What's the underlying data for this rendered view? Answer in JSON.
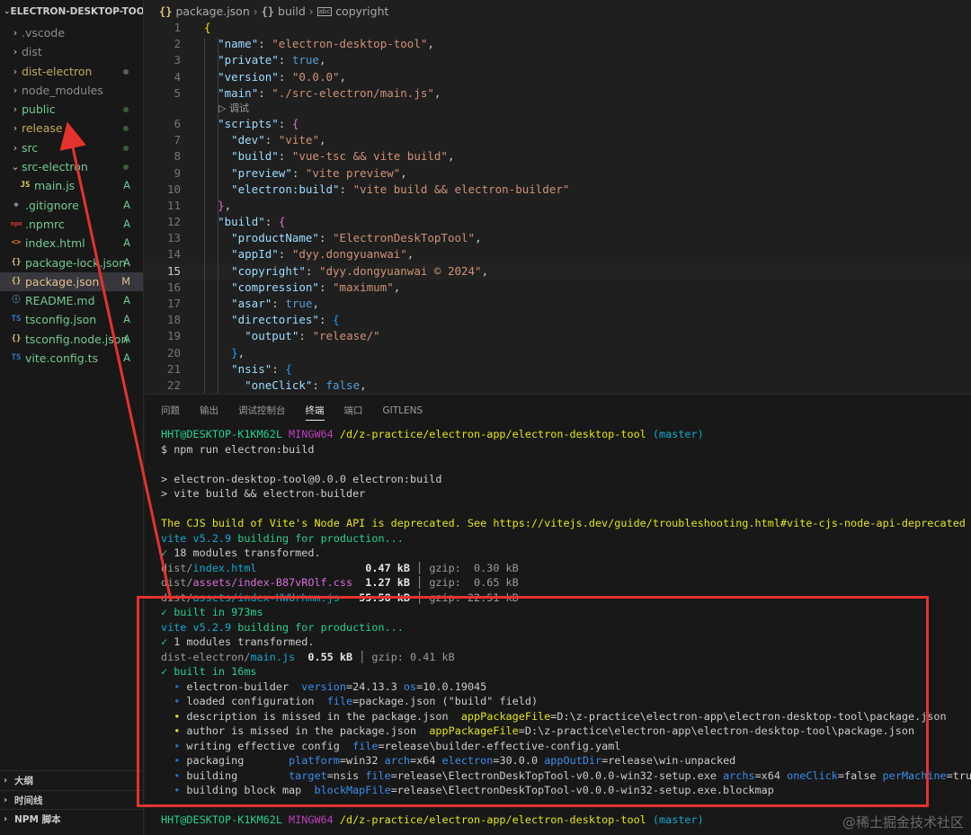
{
  "explorer": {
    "title": "ELECTRON-DESKTOP-TOOL",
    "items": [
      {
        "label": "vscode",
        "prefix": ".",
        "kind": "folder",
        "status": "",
        "dot": false
      },
      {
        "label": "dist",
        "kind": "folder",
        "status": "",
        "dot": false
      },
      {
        "label": "dist-electron",
        "kind": "folder",
        "status": "",
        "dot": true
      },
      {
        "label": "node_modules",
        "kind": "folder",
        "status": "",
        "dot": false
      },
      {
        "label": "public",
        "kind": "folder",
        "status": "",
        "dot": true
      },
      {
        "label": "release",
        "kind": "folder",
        "status": "",
        "dot": true
      },
      {
        "label": "src",
        "kind": "folder",
        "status": "",
        "dot": true
      },
      {
        "label": "src-electron",
        "kind": "folder-open",
        "status": "",
        "dot": true
      },
      {
        "label": "main.js",
        "kind": "file",
        "icon": "JS",
        "status": "A"
      },
      {
        "label": ".gitignore",
        "kind": "file",
        "icon": "◆",
        "status": "A"
      },
      {
        "label": ".npmrc",
        "kind": "file",
        "icon": "npm",
        "status": "A"
      },
      {
        "label": "index.html",
        "kind": "file",
        "icon": "<>",
        "status": "A"
      },
      {
        "label": "package-lock.json",
        "kind": "file",
        "icon": "{}",
        "status": "A"
      },
      {
        "label": "package.json",
        "kind": "file",
        "icon": "{}",
        "status": "M"
      },
      {
        "label": "README.md",
        "kind": "file",
        "icon": "ⓘ",
        "status": "A"
      },
      {
        "label": "tsconfig.json",
        "kind": "file",
        "icon": "TS",
        "status": "A"
      },
      {
        "label": "tsconfig.node.json",
        "kind": "file",
        "icon": "{}",
        "status": "A"
      },
      {
        "label": "vite.config.ts",
        "kind": "file",
        "icon": "TS",
        "status": "A"
      }
    ],
    "outline": "大纲",
    "timeline": "时间线",
    "npm_scripts": "NPM 脚本"
  },
  "editor": {
    "breadcrumb": [
      "package.json",
      "build",
      "copyright"
    ],
    "codelens": "▷ 调试",
    "lines": [
      {
        "n": "1",
        "tokens": [
          [
            "br1",
            "{"
          ]
        ]
      },
      {
        "n": "2",
        "tokens": [
          [
            "p",
            "  "
          ],
          [
            "k",
            "\"name\""
          ],
          [
            "p",
            ": "
          ],
          [
            "s",
            "\"electron-desktop-tool\""
          ],
          [
            "p",
            ","
          ]
        ]
      },
      {
        "n": "3",
        "tokens": [
          [
            "p",
            "  "
          ],
          [
            "k",
            "\"private\""
          ],
          [
            "p",
            ": "
          ],
          [
            "b",
            "true"
          ],
          [
            "p",
            ","
          ]
        ]
      },
      {
        "n": "4",
        "tokens": [
          [
            "p",
            "  "
          ],
          [
            "k",
            "\"version\""
          ],
          [
            "p",
            ": "
          ],
          [
            "s",
            "\"0.0.0\""
          ],
          [
            "p",
            ","
          ]
        ]
      },
      {
        "n": "5",
        "tokens": [
          [
            "p",
            "  "
          ],
          [
            "k",
            "\"main\""
          ],
          [
            "p",
            ": "
          ],
          [
            "s",
            "\"./src-electron/main.js\""
          ],
          [
            "p",
            ","
          ]
        ]
      },
      {
        "n": "6",
        "tokens": [
          [
            "p",
            "  "
          ],
          [
            "k",
            "\"scripts\""
          ],
          [
            "p",
            ": "
          ],
          [
            "br2",
            "{"
          ]
        ]
      },
      {
        "n": "7",
        "tokens": [
          [
            "p",
            "    "
          ],
          [
            "k",
            "\"dev\""
          ],
          [
            "p",
            ": "
          ],
          [
            "s",
            "\"vite\""
          ],
          [
            "p",
            ","
          ]
        ]
      },
      {
        "n": "8",
        "tokens": [
          [
            "p",
            "    "
          ],
          [
            "k",
            "\"build\""
          ],
          [
            "p",
            ": "
          ],
          [
            "s",
            "\"vue-tsc && vite build\""
          ],
          [
            "p",
            ","
          ]
        ]
      },
      {
        "n": "9",
        "tokens": [
          [
            "p",
            "    "
          ],
          [
            "k",
            "\"preview\""
          ],
          [
            "p",
            ": "
          ],
          [
            "s",
            "\"vite preview\""
          ],
          [
            "p",
            ","
          ]
        ]
      },
      {
        "n": "10",
        "tokens": [
          [
            "p",
            "    "
          ],
          [
            "k",
            "\"electron:build\""
          ],
          [
            "p",
            ": "
          ],
          [
            "s",
            "\"vite build && electron-builder\""
          ]
        ]
      },
      {
        "n": "11",
        "tokens": [
          [
            "p",
            "  "
          ],
          [
            "br2",
            "}"
          ],
          [
            "p",
            ","
          ]
        ]
      },
      {
        "n": "12",
        "tokens": [
          [
            "p",
            "  "
          ],
          [
            "k",
            "\"build\""
          ],
          [
            "p",
            ": "
          ],
          [
            "br2",
            "{"
          ]
        ]
      },
      {
        "n": "13",
        "tokens": [
          [
            "p",
            "    "
          ],
          [
            "k",
            "\"productName\""
          ],
          [
            "p",
            ": "
          ],
          [
            "s",
            "\"ElectronDeskTopTool\""
          ],
          [
            "p",
            ","
          ]
        ]
      },
      {
        "n": "14",
        "tokens": [
          [
            "p",
            "    "
          ],
          [
            "k",
            "\"appId\""
          ],
          [
            "p",
            ": "
          ],
          [
            "s",
            "\"dyy.dongyuanwai\""
          ],
          [
            "p",
            ","
          ]
        ]
      },
      {
        "n": "15",
        "active": true,
        "tokens": [
          [
            "p",
            "    "
          ],
          [
            "k",
            "\"copyright\""
          ],
          [
            "p",
            ": "
          ],
          [
            "s",
            "\"dyy.dongyuanwai © 2024\""
          ],
          [
            "p",
            ","
          ]
        ]
      },
      {
        "n": "16",
        "tokens": [
          [
            "p",
            "    "
          ],
          [
            "k",
            "\"compression\""
          ],
          [
            "p",
            ": "
          ],
          [
            "s",
            "\"maximum\""
          ],
          [
            "p",
            ","
          ]
        ]
      },
      {
        "n": "17",
        "tokens": [
          [
            "p",
            "    "
          ],
          [
            "k",
            "\"asar\""
          ],
          [
            "p",
            ": "
          ],
          [
            "b",
            "true"
          ],
          [
            "p",
            ","
          ]
        ]
      },
      {
        "n": "18",
        "tokens": [
          [
            "p",
            "    "
          ],
          [
            "k",
            "\"directories\""
          ],
          [
            "p",
            ": "
          ],
          [
            "br3",
            "{"
          ]
        ]
      },
      {
        "n": "19",
        "tokens": [
          [
            "p",
            "      "
          ],
          [
            "k",
            "\"output\""
          ],
          [
            "p",
            ": "
          ],
          [
            "s",
            "\"release/\""
          ]
        ]
      },
      {
        "n": "20",
        "tokens": [
          [
            "p",
            "    "
          ],
          [
            "br3",
            "}"
          ],
          [
            "p",
            ","
          ]
        ]
      },
      {
        "n": "21",
        "tokens": [
          [
            "p",
            "    "
          ],
          [
            "k",
            "\"nsis\""
          ],
          [
            "p",
            ": "
          ],
          [
            "br3",
            "{"
          ]
        ]
      },
      {
        "n": "22",
        "tokens": [
          [
            "p",
            "      "
          ],
          [
            "k",
            "\"oneClick\""
          ],
          [
            "p",
            ": "
          ],
          [
            "b",
            "false"
          ],
          [
            "p",
            ","
          ]
        ]
      }
    ]
  },
  "panel": {
    "tabs": [
      {
        "label": "问题",
        "active": false
      },
      {
        "label": "输出",
        "active": false
      },
      {
        "label": "调试控制台",
        "active": false
      },
      {
        "label": "终端",
        "active": true
      },
      {
        "label": "端口",
        "active": false
      },
      {
        "label": "GITLENS",
        "active": false
      }
    ],
    "terminal": [
      [
        [
          "t-green",
          "HHT@DESKTOP-K1KM62L "
        ],
        [
          "t-purple",
          "MINGW64 "
        ],
        [
          "t-yellow",
          "/d/z-practice/electron-app/electron-desktop-tool"
        ],
        [
          "t-cyan",
          " (master)"
        ]
      ],
      [
        [
          "",
          "$ npm run electron:build"
        ]
      ],
      [
        [
          "",
          ""
        ]
      ],
      [
        [
          "",
          "> electron-desktop-tool@0.0.0 electron:build"
        ]
      ],
      [
        [
          "",
          "> vite build && electron-builder"
        ]
      ],
      [
        [
          "",
          ""
        ]
      ],
      [
        [
          "t-yellow",
          "The CJS build of Vite's Node API is deprecated. See https://vitejs.dev/guide/troubleshooting.html#vite-cjs-node-api-deprecated for mo"
        ]
      ],
      [
        [
          "t-cyan",
          "vite v5.2.9 "
        ],
        [
          "t-green",
          "building for production..."
        ]
      ],
      [
        [
          "t-green",
          "✓ "
        ],
        [
          "",
          "18 modules transformed."
        ]
      ],
      [
        [
          "t-dim",
          "dist/"
        ],
        [
          "t-cyan",
          "index.html"
        ],
        [
          "",
          "                 "
        ],
        [
          "t-bold",
          "0.47 kB"
        ],
        [
          "t-dim",
          " │ gzip:  0.30 kB"
        ]
      ],
      [
        [
          "t-dim",
          "dist/"
        ],
        [
          "t-magenta",
          "assets/index-B87vROlf.css"
        ],
        [
          "",
          "  "
        ],
        [
          "t-bold",
          "1.27 kB"
        ],
        [
          "t-dim",
          " │ gzip:  0.65 kB"
        ]
      ],
      [
        [
          "t-dim",
          "dist/"
        ],
        [
          "t-cyan",
          "assets/index-HWUrhmm.js"
        ],
        [
          "",
          "   "
        ],
        [
          "t-bold",
          "55.58 kB"
        ],
        [
          "t-dim",
          " │ gzip: 22.51 kB"
        ]
      ],
      [
        [
          "t-green",
          "✓ built in 973ms"
        ]
      ],
      [
        [
          "t-cyan",
          "vite v5.2.9 "
        ],
        [
          "t-green",
          "building for production..."
        ]
      ],
      [
        [
          "t-green",
          "✓ "
        ],
        [
          "",
          "1 modules transformed."
        ]
      ],
      [
        [
          "t-dim",
          "dist-electron/"
        ],
        [
          "t-cyan",
          "main.js"
        ],
        [
          "",
          "  "
        ],
        [
          "t-bold",
          "0.55 kB"
        ],
        [
          "t-dim",
          " │ gzip: 0.41 kB"
        ]
      ],
      [
        [
          "t-green",
          "✓ built in 16ms"
        ]
      ],
      [
        [
          "bullet-c",
          "  • "
        ],
        [
          "",
          "electron-builder  "
        ],
        [
          "t-lblue",
          "version"
        ],
        [
          "",
          "=24.13.3 "
        ],
        [
          "t-lblue",
          "os"
        ],
        [
          "",
          "=10.0.19045"
        ]
      ],
      [
        [
          "bullet-c",
          "  • "
        ],
        [
          "",
          "loaded configuration  "
        ],
        [
          "t-lblue",
          "file"
        ],
        [
          "",
          "=package.json (\"build\" field)"
        ]
      ],
      [
        [
          "bullet-y",
          "  • "
        ],
        [
          "",
          "description is missed in the package.json  "
        ],
        [
          "t-yellow",
          "appPackageFile"
        ],
        [
          "",
          "=D:\\z-practice\\electron-app\\electron-desktop-tool\\package.json"
        ]
      ],
      [
        [
          "bullet-y",
          "  • "
        ],
        [
          "",
          "author is missed in the package.json  "
        ],
        [
          "t-yellow",
          "appPackageFile"
        ],
        [
          "",
          "=D:\\z-practice\\electron-app\\electron-desktop-tool\\package.json"
        ]
      ],
      [
        [
          "bullet-c",
          "  • "
        ],
        [
          "",
          "writing effective config  "
        ],
        [
          "t-lblue",
          "file"
        ],
        [
          "",
          "=release\\builder-effective-config.yaml"
        ]
      ],
      [
        [
          "bullet-c",
          "  • "
        ],
        [
          "",
          "packaging       "
        ],
        [
          "t-lblue",
          "platform"
        ],
        [
          "",
          "=win32 "
        ],
        [
          "t-lblue",
          "arch"
        ],
        [
          "",
          "=x64 "
        ],
        [
          "t-lblue",
          "electron"
        ],
        [
          "",
          "=30.0.0 "
        ],
        [
          "t-lblue",
          "appOutDir"
        ],
        [
          "",
          "=release\\win-unpacked"
        ]
      ],
      [
        [
          "bullet-c",
          "  • "
        ],
        [
          "",
          "building        "
        ],
        [
          "t-lblue",
          "target"
        ],
        [
          "",
          "=nsis "
        ],
        [
          "t-lblue",
          "file"
        ],
        [
          "",
          "=release\\ElectronDeskTopTool-v0.0.0-win32-setup.exe "
        ],
        [
          "t-lblue",
          "archs"
        ],
        [
          "",
          "=x64 "
        ],
        [
          "t-lblue",
          "oneClick"
        ],
        [
          "",
          "=false "
        ],
        [
          "t-lblue",
          "perMachine"
        ],
        [
          "",
          "=true"
        ]
      ],
      [
        [
          "bullet-c",
          "  • "
        ],
        [
          "",
          "building block map  "
        ],
        [
          "t-lblue",
          "blockMapFile"
        ],
        [
          "",
          "=release\\ElectronDeskTopTool-v0.0.0-win32-setup.exe.blockmap"
        ]
      ],
      [
        [
          "",
          ""
        ]
      ],
      [
        [
          "t-green",
          "HHT@DESKTOP-K1KM62L "
        ],
        [
          "t-purple",
          "MINGW64 "
        ],
        [
          "t-yellow",
          "/d/z-practice/electron-app/electron-desktop-tool"
        ],
        [
          "t-cyan",
          " (master)"
        ]
      ]
    ]
  },
  "watermark": "@稀土掘金技术社区",
  "colors": {
    "annotation": "#e5322d",
    "accent": "#73c991"
  }
}
